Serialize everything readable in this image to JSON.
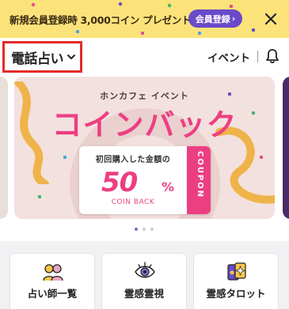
{
  "promo_banner": {
    "text": "新規会員登録時 3,000コイン プレゼント!",
    "cta_label": "会員登録",
    "cta_arrow": "›",
    "cta_color": "#6b4ac9",
    "background_color": "#fbe37a",
    "close_icon": "close-icon"
  },
  "header": {
    "site_selector_label": "電話占い",
    "site_selector_icon": "chevron-down-icon",
    "event_link": "イベント",
    "notification_icon": "bell-icon"
  },
  "carousel": {
    "slide": {
      "kicker": "ホンカフェ イベント",
      "headline": "コインバック",
      "coupon_description": "初回購入した金額の",
      "coupon_percent": "50",
      "coupon_percent_sign": "%",
      "coupon_caption": "COIN BACK",
      "coupon_stub_text": "COUPON",
      "accent_color": "#ec3f82"
    },
    "page_count": 3,
    "active_page": 1
  },
  "categories": [
    {
      "label": "占い師一覧",
      "icon": "fortune-tellers-icon"
    },
    {
      "label": "霊感霊視",
      "icon": "third-eye-icon"
    },
    {
      "label": "霊感タロット",
      "icon": "tarot-cards-icon"
    }
  ]
}
